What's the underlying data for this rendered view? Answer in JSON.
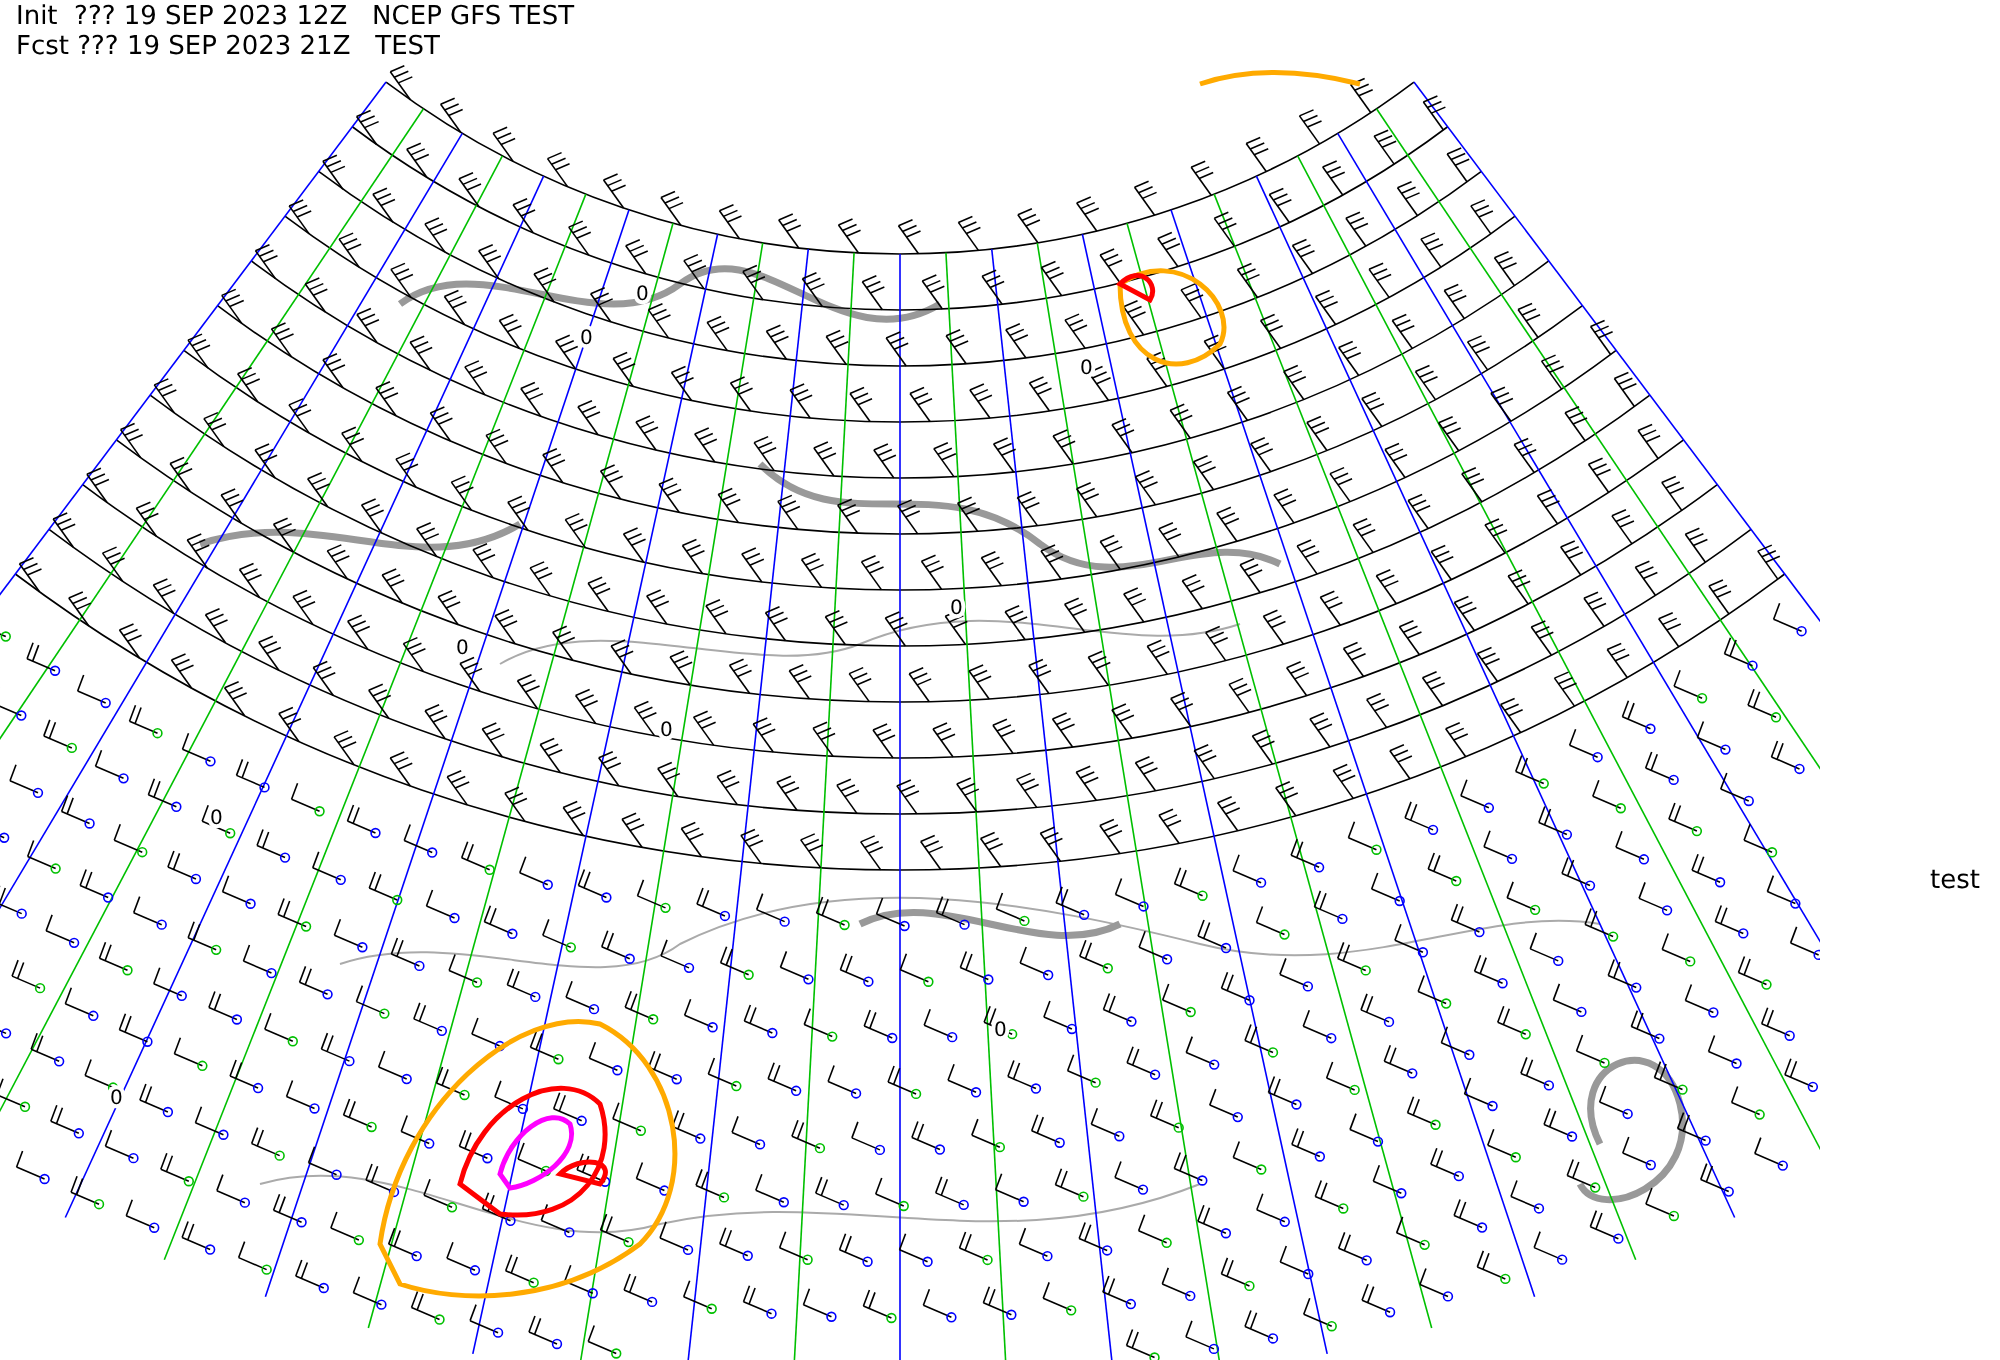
{
  "header": {
    "lines": [
      "Init  ??? 19 SEP 2023 12Z   NCEP GFS TEST",
      "Fcst ??? 19 SEP 2023 21Z   TEST"
    ]
  },
  "contour_labels": [
    "0",
    "0",
    "0",
    "0",
    "0",
    "0",
    "0",
    "0",
    "0"
  ],
  "side_label": "test"
}
